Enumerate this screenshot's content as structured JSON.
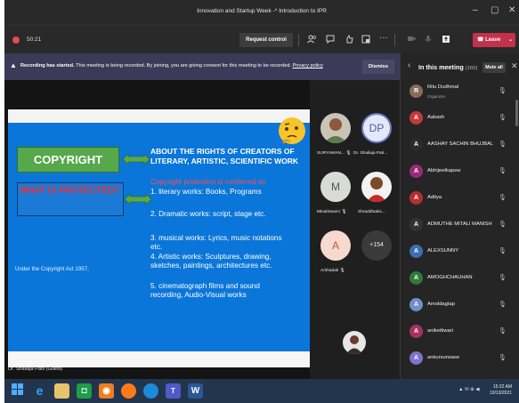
{
  "window": {
    "title": "Innovation and Startup Week -* Introduction to IPR",
    "minimize": "–",
    "maximize": "▢",
    "close": "✕"
  },
  "toolbar": {
    "timer": "50:21",
    "request_control": "Request control",
    "leave": "Leave"
  },
  "recording_bar": {
    "bold": "Recording has started.",
    "message": "This meeting is being recorded. By joining, you are giving consent for this meeting to be recorded.",
    "link": "Privacy policy",
    "dismiss": "Dismiss"
  },
  "slide": {
    "copyright": "COPYRIGHT",
    "what_protected": "WHAT IS PROTECTED?",
    "rights_title_1": "ABOUT THE RIGHTS OF CREATORS OF",
    "rights_title_2": "LITERARY, ARTISTIC, SCIENTIFIC WORK",
    "under_act": "Under the Copyright Act 1957,",
    "line_red": "Copyright protection is conferred on",
    "line_1": "1.  literary works: Books, Programs",
    "line_2": "2. Dramatic works: script, stage etc.",
    "line_3a": "3. musical works: Lyrics, music notations",
    "line_3b": "etc.",
    "line_4a": "4. Artistic works: Sculptures, drawing,",
    "line_4b": "sketches, paintings, architectures etc.",
    "line_5a": "5. cinematograph films and sound",
    "line_5b": "recording, Audio-Visual works"
  },
  "presenter_label": "Dr. Shailaja Patil (Guest)",
  "tiles": {
    "t1": "SURYAWAN...",
    "t2_initials": "DP",
    "t2": "Dr. Shailaja Pati...",
    "t3_initials": "M",
    "t3": "MinalSwami",
    "t4": "Shraddhakis...",
    "t5_initials": "A",
    "t5": "Arshadali",
    "more": "+154"
  },
  "panel": {
    "title": "In this meeting",
    "count": "(160)",
    "mute_all": "Mute all",
    "participants": [
      {
        "name": "Ritu Dudhmal",
        "role": "Organizer",
        "initial": "R",
        "color": "#8a6b5a"
      },
      {
        "name": "Aakash",
        "role": "",
        "initial": "A",
        "color": "#c23a3a"
      },
      {
        "name": "AASHAY SACHIN BHUJBAL",
        "role": "",
        "initial": "A",
        "color": "#2b2b2b"
      },
      {
        "name": "Abhijeetkapsw",
        "role": "",
        "initial": "A",
        "color": "#9a2b7a"
      },
      {
        "name": "Aditya",
        "role": "",
        "initial": "A",
        "color": "#b33030"
      },
      {
        "name": "ADMUTHE MITALI MANISH",
        "role": "",
        "initial": "A",
        "color": "#333333"
      },
      {
        "name": "ALEXSUNNY",
        "role": "",
        "initial": "A",
        "color": "#3c6fb0"
      },
      {
        "name": "AMOGHCHAUHAN",
        "role": "",
        "initial": "A",
        "color": "#2f7a3b"
      },
      {
        "name": "Amoldagtap",
        "role": "",
        "initial": "A",
        "color": "#6e8fc9"
      },
      {
        "name": "anikettiwari",
        "role": "",
        "initial": "A",
        "color": "#a8325e"
      },
      {
        "name": "ankursurwase",
        "role": "",
        "initial": "A",
        "color": "#7b74c9"
      }
    ]
  },
  "taskbar": {
    "tray": "▲ ✉ ⊕ ◀",
    "time": "15:22 AM",
    "date": "10/13/2021"
  }
}
